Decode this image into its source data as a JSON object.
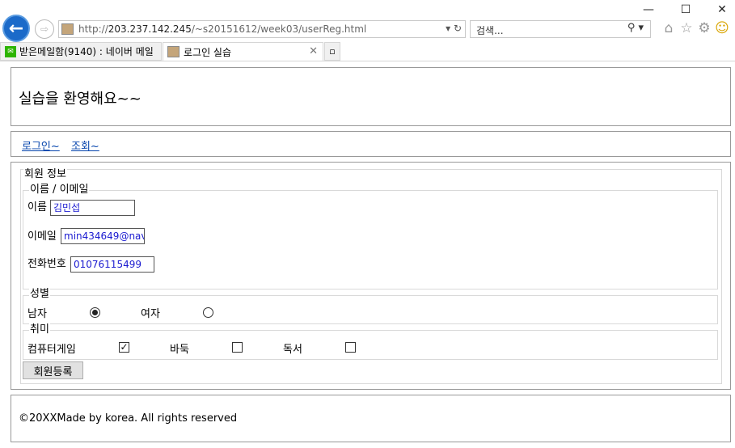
{
  "browser": {
    "url_prefix": "http://",
    "url_host": "203.237.142.245",
    "url_path": "/~s20151612/week03/userReg.html",
    "search_placeholder": "검색...",
    "tabs": [
      {
        "label": "받은메일함(9140) : 네이버 메일"
      },
      {
        "label": "로그인 실습"
      }
    ],
    "window_controls": {
      "minimize": "—",
      "maximize": "☐",
      "close": "✕"
    }
  },
  "header": {
    "title": "실습을 환영해요~~"
  },
  "nav": {
    "links": [
      {
        "label": "로그인~"
      },
      {
        "label": "조회~"
      }
    ]
  },
  "form": {
    "legend": "회원 정보",
    "name_email": {
      "legend": "이름 / 이메일",
      "name_label": "이름",
      "name_value": "김민섭",
      "email_label": "이메일",
      "email_value": "min434649@nav",
      "phone_label": "전화번호",
      "phone_value": "01076115499"
    },
    "gender": {
      "legend": "성별",
      "options": [
        {
          "label": "남자",
          "checked": true
        },
        {
          "label": "여자",
          "checked": false
        }
      ]
    },
    "hobby": {
      "legend": "취미",
      "options": [
        {
          "label": "컴퓨터게임",
          "checked": true
        },
        {
          "label": "바둑",
          "checked": false
        },
        {
          "label": "독서",
          "checked": false
        }
      ]
    },
    "submit_label": "회원등록"
  },
  "footer": {
    "text": "©20XXMade by korea. All rights reserved"
  }
}
